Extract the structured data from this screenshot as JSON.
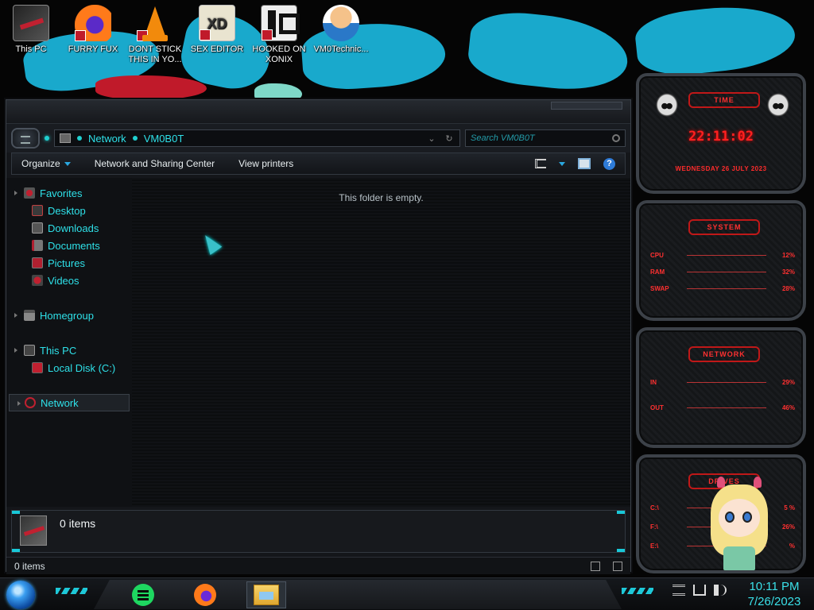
{
  "desktop": {
    "icons": [
      {
        "label": "This PC",
        "icon": "this-pc-icon"
      },
      {
        "label": "FURRY FUX",
        "icon": "firefox-icon"
      },
      {
        "label": "DONT STICK THIS IN YO...",
        "icon": "vlc-icon"
      },
      {
        "label": "SEX EDITOR",
        "icon": "hxd-editor-icon"
      },
      {
        "label": "HOOKED ON XONIX",
        "icon": "xonix-icon"
      },
      {
        "label": "VM0Technic...",
        "icon": "doctor-icon"
      }
    ],
    "wallpaper_color": "#19a9cc"
  },
  "explorer": {
    "address": {
      "crumbs": [
        "Network",
        "VM0B0T"
      ]
    },
    "search": {
      "placeholder": "Search VM0B0T"
    },
    "toolbar": {
      "organize": "Organize",
      "network_sharing": "Network and Sharing Center",
      "view_printers": "View printers"
    },
    "nav": {
      "favorites": "Favorites",
      "desktop": "Desktop",
      "downloads": "Downloads",
      "documents": "Documents",
      "pictures": "Pictures",
      "videos": "Videos",
      "homegroup": "Homegroup",
      "this_pc": "This PC",
      "local_disk": "Local Disk (C:)",
      "network": "Network"
    },
    "content": {
      "empty_message": "This folder is empty."
    },
    "details": {
      "count": "0 items"
    },
    "status": {
      "count": "0 items"
    },
    "accent_color": "#2ee0e8"
  },
  "widgets": {
    "time": {
      "title": "time",
      "clock": "22:11:02",
      "date": "wednesday 26 july 2023"
    },
    "system": {
      "title": "system",
      "rows": [
        {
          "label": "CPU",
          "value": "12%"
        },
        {
          "label": "RAM",
          "value": "32%"
        },
        {
          "label": "SWAP",
          "value": "28%"
        }
      ]
    },
    "network": {
      "title": "network",
      "rows": [
        {
          "label": "IN",
          "value": "29%"
        },
        {
          "label": "OUT",
          "value": "46%"
        }
      ]
    },
    "drives": {
      "title": "drives",
      "rows": [
        {
          "label": "C:\\",
          "value": "5 %"
        },
        {
          "label": "F:\\",
          "value": "26%"
        },
        {
          "label": "E:\\",
          "value": "%"
        }
      ]
    },
    "accent_color": "#ff2020"
  },
  "taskbar": {
    "apps": [
      {
        "name": "Spotify",
        "icon": "spotify-icon"
      },
      {
        "name": "Firefox",
        "icon": "firefox-icon"
      },
      {
        "name": "File Explorer",
        "icon": "folder-icon",
        "active": true
      }
    ],
    "clock": {
      "time": "10:11 PM",
      "date": "7/26/2023"
    }
  }
}
